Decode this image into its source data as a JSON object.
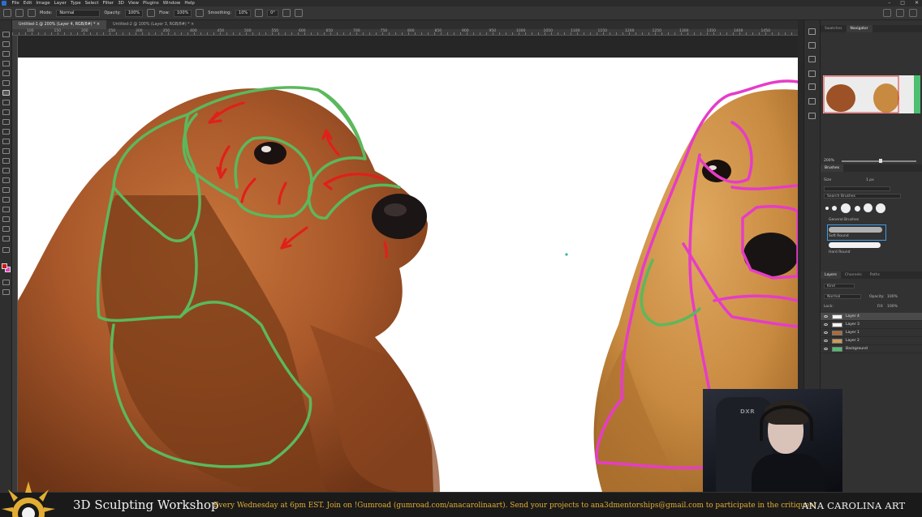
{
  "menubar": {
    "items": [
      "File",
      "Edit",
      "Image",
      "Layer",
      "Type",
      "Select",
      "Filter",
      "3D",
      "View",
      "Plugins",
      "Window",
      "Help"
    ],
    "window_controls": [
      "–",
      "□",
      "✕"
    ]
  },
  "options": {
    "mode_label": "Mode:",
    "mode_value": "Normal",
    "opacity_label": "Opacity:",
    "opacity_value": "100%",
    "flow_label": "Flow:",
    "flow_value": "100%",
    "smoothing_label": "Smoothing:",
    "smoothing_value": "10%",
    "angle_value": "0°"
  },
  "doc_tabs": [
    {
      "label": "Untitled-1 @ 200% (Layer 4, RGB/8#) *  ×",
      "active": true
    },
    {
      "label": "Untitled-2 @ 100% (Layer 3, RGB/8#) *  ×",
      "active": false
    }
  ],
  "ruler_labels": [
    "100",
    "150",
    "200",
    "250",
    "300",
    "350",
    "400",
    "450",
    "500",
    "550",
    "600",
    "650",
    "700",
    "750",
    "800",
    "850",
    "900",
    "950",
    "1000",
    "1050",
    "1100",
    "1150",
    "1200",
    "1250",
    "1300",
    "1350",
    "1400",
    "1450"
  ],
  "panels": {
    "top_tabs": [
      "Swatches",
      "Navigator"
    ],
    "active_top_tab": "Navigator",
    "zoom_value": "200%",
    "brushes_title": "Brushes",
    "size_label": "Size",
    "size_value": "1 px",
    "search_placeholder": "Search Brushes",
    "brush_group": "General Brushes",
    "brush_names": [
      "Soft Round",
      "Hard Round"
    ],
    "layer_tabs": [
      "Layers",
      "Channels",
      "Paths"
    ],
    "layer_filter": "Kind",
    "blend_mode": "Normal",
    "opacity_label": "Opacity:",
    "opacity_value": "100%",
    "lock_label": "Lock:",
    "fill_label": "Fill:",
    "fill_value": "100%",
    "layers": [
      {
        "name": "Layer 4",
        "selected": true
      },
      {
        "name": "Layer 3",
        "selected": false
      },
      {
        "name": "Layer 1",
        "selected": false
      },
      {
        "name": "Layer 2",
        "selected": false
      },
      {
        "name": "Background",
        "selected": false
      }
    ]
  },
  "webcam": {
    "chair_brand": "DXR"
  },
  "banner": {
    "title": "3D Sculpting Workshop",
    "info": "Every Wednesday at 6pm EST. Join on !Gumroad (gumroad.com/anacarolinaart). Send your projects to ana3dmentorships@gmail.com to participate in the critiques!",
    "brand": "ANA CAROLINA ART"
  },
  "colors": {
    "foreground": "#d01818",
    "background": "#e040c0",
    "guide_green": "#5cb85c",
    "guide_magenta": "#e63cc8",
    "arrow_red": "#e0201a",
    "banner_gold": "#e3ad34"
  }
}
